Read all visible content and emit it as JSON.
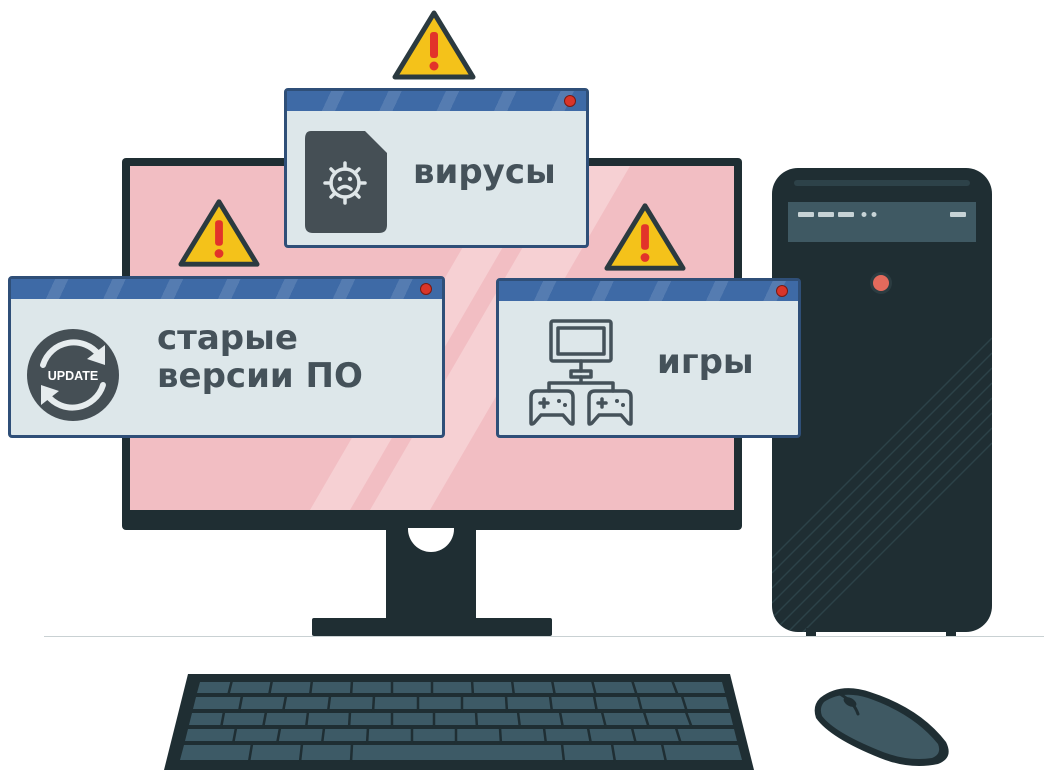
{
  "colors": {
    "frame": "#1f2e33",
    "screen": "#f2bec3",
    "window_bg": "#dde7ea",
    "window_bar": "#3e6aa6",
    "window_border": "#2f4f78",
    "text": "#45525a",
    "warning": "#f4c21a",
    "close_dot": "#d93529"
  },
  "windows": {
    "viruses": {
      "label": "вирусы",
      "icon": "virus-file-icon"
    },
    "old_software": {
      "line1": "старые",
      "line2": "версии ПО",
      "icon_text": "UPDATE",
      "icon": "update-icon"
    },
    "games": {
      "label": "игры",
      "icon": "computer-gamepads-icon"
    }
  }
}
